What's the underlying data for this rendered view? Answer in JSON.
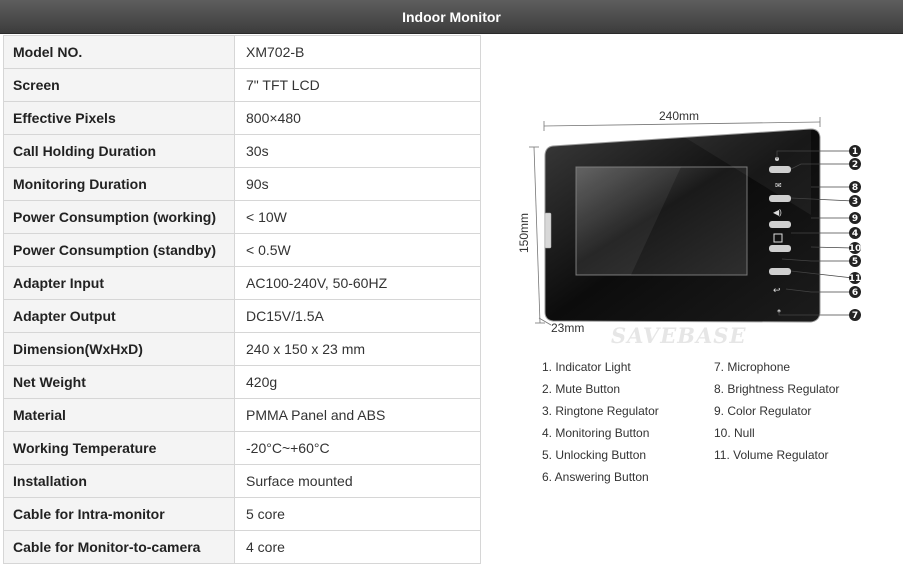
{
  "header": {
    "title": "Indoor Monitor"
  },
  "specs": [
    {
      "label": "Model NO.",
      "value": "XM702-B"
    },
    {
      "label": "Screen",
      "value": "7\" TFT LCD"
    },
    {
      "label": "Effective Pixels",
      "value": "800×480"
    },
    {
      "label": "Call Holding Duration",
      "value": "30s"
    },
    {
      "label": "Monitoring Duration",
      "value": "90s"
    },
    {
      "label": "Power Consumption (working)",
      "value": "< 10W"
    },
    {
      "label": "Power Consumption (standby)",
      "value": "< 0.5W"
    },
    {
      "label": "Adapter Input",
      "value": "AC100-240V, 50-60HZ"
    },
    {
      "label": "Adapter Output",
      "value": "DC15V/1.5A"
    },
    {
      "label": "Dimension(WxHxD)",
      "value": "240 x 150 x 23 mm"
    },
    {
      "label": "Net Weight",
      "value": "420g"
    },
    {
      "label": "Material",
      "value": "PMMA Panel and ABS"
    },
    {
      "label": "Working Temperature",
      "value": "-20°C~+60°C"
    },
    {
      "label": "Installation",
      "value": "Surface mounted"
    },
    {
      "label": "Cable for Intra-monitor",
      "value": "5 core"
    },
    {
      "label": "Cable for Monitor-to-camera",
      "value": "4 core"
    }
  ],
  "diagram": {
    "width_label": "240mm",
    "height_label": "150mm",
    "depth_label": "23mm",
    "watermark": "SAVEBASE",
    "callouts": [
      "1",
      "2",
      "8",
      "3",
      "9",
      "4",
      "10",
      "5",
      "11",
      "6",
      "7"
    ]
  },
  "legend": {
    "left": [
      "1. Indicator Light",
      "2. Mute Button",
      "3. Ringtone Regulator",
      "4. Monitoring Button",
      "5. Unlocking Button",
      "6. Answering Button"
    ],
    "right": [
      "7. Microphone",
      "8. Brightness Regulator",
      "9. Color Regulator",
      "10. Null",
      "11. Volume Regulator"
    ]
  }
}
